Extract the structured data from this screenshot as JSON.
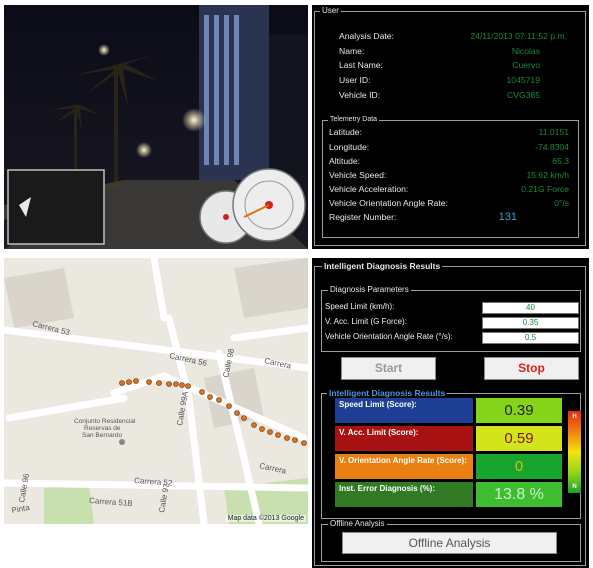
{
  "user_panel": {
    "legend": "User",
    "fields": [
      {
        "label": "Analysis Date:",
        "value": "24/11/2013 07:11:52 p.m."
      },
      {
        "label": "Name:",
        "value": "Nicolas"
      },
      {
        "label": "Last Name:",
        "value": "Cuervo"
      },
      {
        "label": "User ID:",
        "value": "1045719"
      },
      {
        "label": "Vehicle ID:",
        "value": "CVG385"
      }
    ],
    "telemetry": {
      "legend": "Telemetry Data",
      "fields": [
        {
          "label": "Latitude:",
          "value": "11.0151"
        },
        {
          "label": "Longitude:",
          "value": "-74.8304"
        },
        {
          "label": "Altitude:",
          "value": "65.3"
        },
        {
          "label": "Vehicle Speed:",
          "value": "15.62 km/h"
        },
        {
          "label": "Vehicle Acceleration:",
          "value": "0.21G Force"
        },
        {
          "label": "Vehicle Orientation Angle Rate:",
          "value": "0°/s"
        },
        {
          "label": "Register Number:",
          "value": "131"
        }
      ]
    }
  },
  "map": {
    "streets": [
      "Carrera 53",
      "Carrera 56",
      "Carrera",
      "Calle 98",
      "Calle 99A",
      "Carrera 52",
      "Carrera 51B",
      "Carrera",
      "Calle 97",
      "Calle 96",
      "Pinta"
    ],
    "labels": [
      "Conjunto Residencial",
      "Reservas de",
      "San Bernardo"
    ],
    "attribution": "Map data ©2013 Google"
  },
  "diagnosis": {
    "title": "Intelligent Diagnosis Results",
    "params_legend": "Diagnosis Parameters",
    "params": [
      {
        "label": "Speed Limit (km/h):",
        "value": "40"
      },
      {
        "label": "V. Acc. Limit (G Force):",
        "value": "0.35"
      },
      {
        "label": "Vehicle Orientation Angle Rate (°/s):",
        "value": "0.5"
      }
    ],
    "start_label": "Start",
    "stop_label": "Stop",
    "results_legend": "Intelligent Diagnosis Results",
    "scores": [
      {
        "label": "Speed Limit (Score):",
        "value": "0.39",
        "label_color": "#1f3f94",
        "value_color": "#86d41a"
      },
      {
        "label": "V. Acc. Limit (Score):",
        "value": "0.59",
        "label_color": "#a81212",
        "value_color": "#d4e41a"
      },
      {
        "label": "V. Orientation Angle Rate (Score):",
        "value": "0",
        "label_color": "#ea7f12",
        "value_color": "#17a52d"
      },
      {
        "label": "Inst. Error Diagnosis (%):",
        "value": "13.8 %",
        "label_color": "#2f7a22",
        "value_color": "#3fbd31"
      }
    ],
    "colorbar_labels": [
      "H",
      "N"
    ],
    "offline_legend": "Offline Analysis",
    "offline_button": "Offline Analysis"
  }
}
